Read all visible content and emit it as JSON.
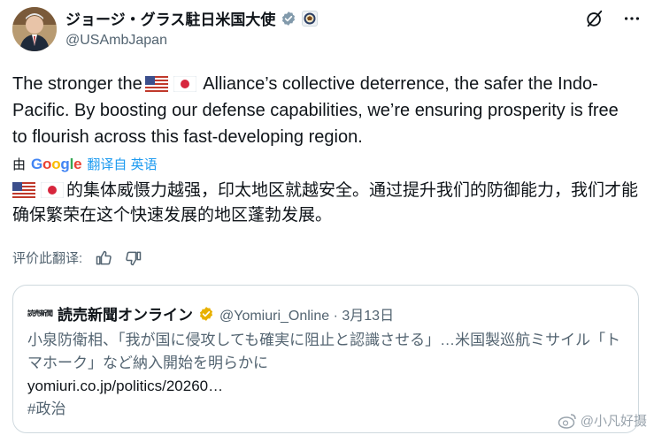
{
  "author": {
    "name": "ジョージ・グラス駐日米国大使",
    "handle": "@USAmbJapan"
  },
  "tweet": {
    "text_pre": "The stronger the",
    "text_post": " Alliance’s collective deterrence, the safer the Indo-Pacific. By boosting our defense capabilities, we’re ensuring prosperity is free to flourish across this fast-developing region."
  },
  "translation": {
    "by": "由",
    "google": [
      "G",
      "o",
      "o",
      "g",
      "l",
      "e"
    ],
    "link": "翻译自 英语",
    "text": "的集体威慑力越强，印太地区就越安全。通过提升我们的防御能力，我们才能确保繁荣在这个快速发展的地区蓬勃发展。"
  },
  "rate": {
    "label": "评价此翻译:"
  },
  "quote": {
    "logo_text": "読売新聞",
    "name": "読売新聞オンライン",
    "handle": "@Yomiuri_Online · 3月13日",
    "body": "小泉防衛相、「我が国に侵攻しても確実に阻止と認識させる」…米国製巡航ミサイル「トマホーク」など納入開始を明らかに",
    "url": "yomiuri.co.jp/politics/20260…",
    "hashtag": "#政治"
  },
  "watermark": {
    "text": "@小凡好摄"
  },
  "icons": {
    "verified": "verified-badge-icon",
    "seal": "government-seal-icon",
    "grok": "grok-icon",
    "more": "more-icon",
    "thumbs_up": "thumbs-up-icon",
    "thumbs_down": "thumbs-down-icon"
  },
  "colors": {
    "link": "#1d9bf0",
    "secondary": "#536471",
    "verified_gray": "#829aab",
    "verified_gold": "#e8b100"
  }
}
